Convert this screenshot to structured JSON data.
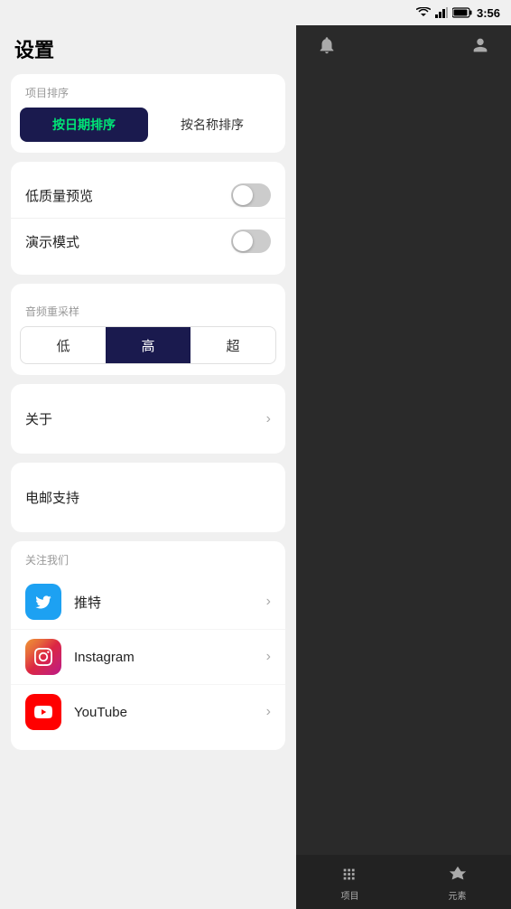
{
  "statusBar": {
    "time": "3:56"
  },
  "settings": {
    "pageTitle": "设置",
    "sortSection": {
      "label": "项目排序",
      "buttons": [
        {
          "id": "by-date",
          "label": "按日期排序",
          "active": true
        },
        {
          "id": "by-name",
          "label": "按名称排序",
          "active": false
        }
      ]
    },
    "toggleSection": {
      "items": [
        {
          "id": "low-quality",
          "label": "低质量预览",
          "on": false
        },
        {
          "id": "demo-mode",
          "label": "演示模式",
          "on": false
        }
      ]
    },
    "resampleSection": {
      "label": "音频重采样",
      "buttons": [
        {
          "id": "low",
          "label": "低",
          "active": false
        },
        {
          "id": "high",
          "label": "高",
          "active": true
        },
        {
          "id": "ultra",
          "label": "超",
          "active": false
        }
      ]
    },
    "aboutSection": {
      "label": "关于",
      "hasChevron": true
    },
    "emailSection": {
      "label": "电邮支持",
      "hasChevron": false
    },
    "followSection": {
      "sectionLabel": "关注我们",
      "items": [
        {
          "id": "twitter",
          "label": "推特",
          "iconType": "twitter"
        },
        {
          "id": "instagram",
          "label": "Instagram",
          "iconType": "instagram"
        },
        {
          "id": "youtube",
          "label": "YouTube",
          "iconType": "youtube"
        }
      ]
    }
  },
  "bottomTabs": [
    {
      "id": "projects",
      "label": "项目",
      "icon": "grid"
    },
    {
      "id": "elements",
      "label": "元素",
      "icon": "shapes"
    }
  ]
}
